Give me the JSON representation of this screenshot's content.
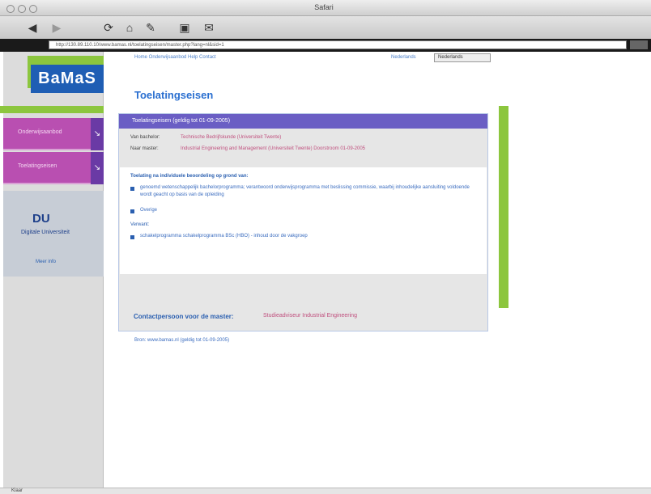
{
  "window": {
    "title": "Safari"
  },
  "toolbar": {
    "back_icon": "left-arrow-icon",
    "forward_icon": "right-arrow-icon",
    "reload_icon": "reload-icon",
    "home_icon": "home-icon",
    "bookmarks_icon": "bookmarks-icon",
    "print_icon": "print-icon",
    "mail_icon": "mail-icon"
  },
  "address": {
    "url": "http://130.89.110.10/www.bamas.nl/toelatingseisen/master.php?lang=nl&sid=1"
  },
  "site": {
    "logo": "BaMaS"
  },
  "topnav": {
    "links": "Home   Onderwijsaanbod   Help   Contact"
  },
  "lang": {
    "label": "Nederlands",
    "select": "Nederlands"
  },
  "sidebar": {
    "item1": "Onderwijsaanbod",
    "item2": "Toelatingseisen",
    "du_logo": "DU",
    "du_sub": "Digitale Universiteit",
    "du_link": "Meer info"
  },
  "page": {
    "title": "Toelatingseisen"
  },
  "panel": {
    "heading": "Toelatingseisen (geldig tot 01-09-2005)",
    "row1_label": "Van bachelor:",
    "row1_value": "Technische Bedrijfskunde (Universiteit Twente)",
    "row2_label": "Naar master:",
    "row2_value": "Industrial Engineering and Management (Universiteit Twente) Doorstroom 01-09-2005",
    "section_title": "Toelating na individuele beoordeling op grond van:",
    "bullet1": "genoemd wetenschappelijk bachelorprogramma; verantwoord onderwijsprogramma met beslissing commissie, waarbij inhoudelijke aansluiting voldoende wordt geacht op basis van de opleiding",
    "bullet2": "Overige",
    "extra_title": "Verwant:",
    "bullet3": "schakelprogramma schakelprogramma BSc (HBO) - inhoud door de vakgroep",
    "contact_label": "Contactpersoon voor de master:",
    "contact_value": "Studieadviseur Industrial Engineering"
  },
  "footer": {
    "text": "Bron: www.bamas.nl (geldig tot 01-09-2005)"
  },
  "status": {
    "text": "Klaar"
  }
}
